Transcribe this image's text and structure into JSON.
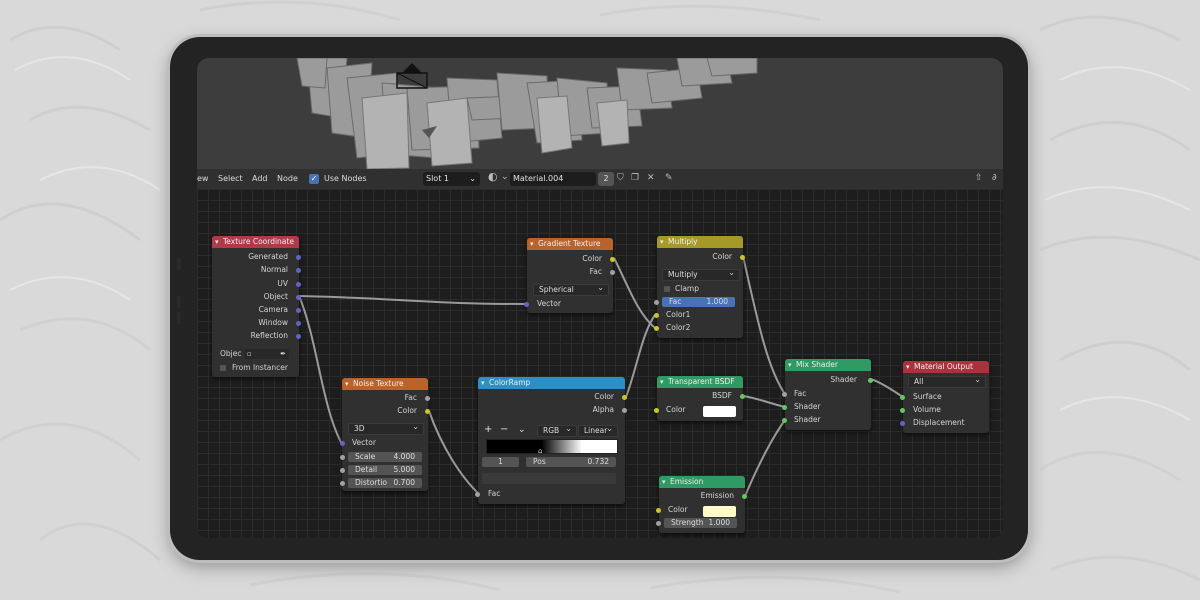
{
  "header": {
    "menu_view": "ew",
    "menu_select": "Select",
    "menu_add": "Add",
    "menu_node": "Node",
    "use_nodes_label": "Use Nodes",
    "slot": "Slot 1",
    "material_name": "Material.004",
    "user_count": "2"
  },
  "nodes": {
    "texture_coordinate": {
      "title": "Texture Coordinate",
      "outputs": [
        "Generated",
        "Normal",
        "UV",
        "Object",
        "Camera",
        "Window",
        "Reflection"
      ],
      "object_label": "Objec",
      "from_instancer": "From Instancer"
    },
    "noise_texture": {
      "title": "Noise Texture",
      "out_fac": "Fac",
      "out_color": "Color",
      "dimension": "3D",
      "in_vector": "Vector",
      "scale_label": "Scale",
      "scale_value": "4.000",
      "detail_label": "Detail",
      "detail_value": "5.000",
      "distortion_label": "Distortio",
      "distortion_value": "0.700"
    },
    "gradient_texture": {
      "title": "Gradient Texture",
      "out_color": "Color",
      "out_fac": "Fac",
      "type": "Spherical",
      "in_vector": "Vector"
    },
    "colorramp": {
      "title": "ColorRamp",
      "out_color": "Color",
      "out_alpha": "Alpha",
      "add": "+",
      "remove": "−",
      "mode": "RGB",
      "interpolation": "Linear",
      "stop_index": "1",
      "pos_label": "Pos",
      "pos_value": "0.732",
      "in_fac": "Fac"
    },
    "multiply": {
      "title": "Multiply",
      "out_color": "Color",
      "blend": "Multiply",
      "clamp": "Clamp",
      "fac_label": "Fac",
      "fac_value": "1.000",
      "in_color1": "Color1",
      "in_color2": "Color2"
    },
    "transparent_bsdf": {
      "title": "Transparent BSDF",
      "out_bsdf": "BSDF",
      "in_color": "Color"
    },
    "emission": {
      "title": "Emission",
      "out_emission": "Emission",
      "in_color": "Color",
      "strength_label": "Strength",
      "strength_value": "1.000"
    },
    "mix_shader": {
      "title": "Mix Shader",
      "out_shader": "Shader",
      "in_fac": "Fac",
      "in_shader1": "Shader",
      "in_shader2": "Shader"
    },
    "material_output": {
      "title": "Material Output",
      "target": "All",
      "in_surface": "Surface",
      "in_volume": "Volume",
      "in_displacement": "Displacement"
    }
  },
  "colors": {
    "input_header": "#b03a4a",
    "texture_header": "#b8632c",
    "converter_header": "#2e8fc4",
    "color_header": "#a59a27",
    "shader_header": "#2f9a63",
    "output_header": "#a9333d",
    "socket_vector": "#6363c7",
    "socket_color": "#c7c729",
    "socket_float": "#a1a1a1",
    "socket_shader": "#63c763",
    "highlight_field": "#4772b3"
  }
}
